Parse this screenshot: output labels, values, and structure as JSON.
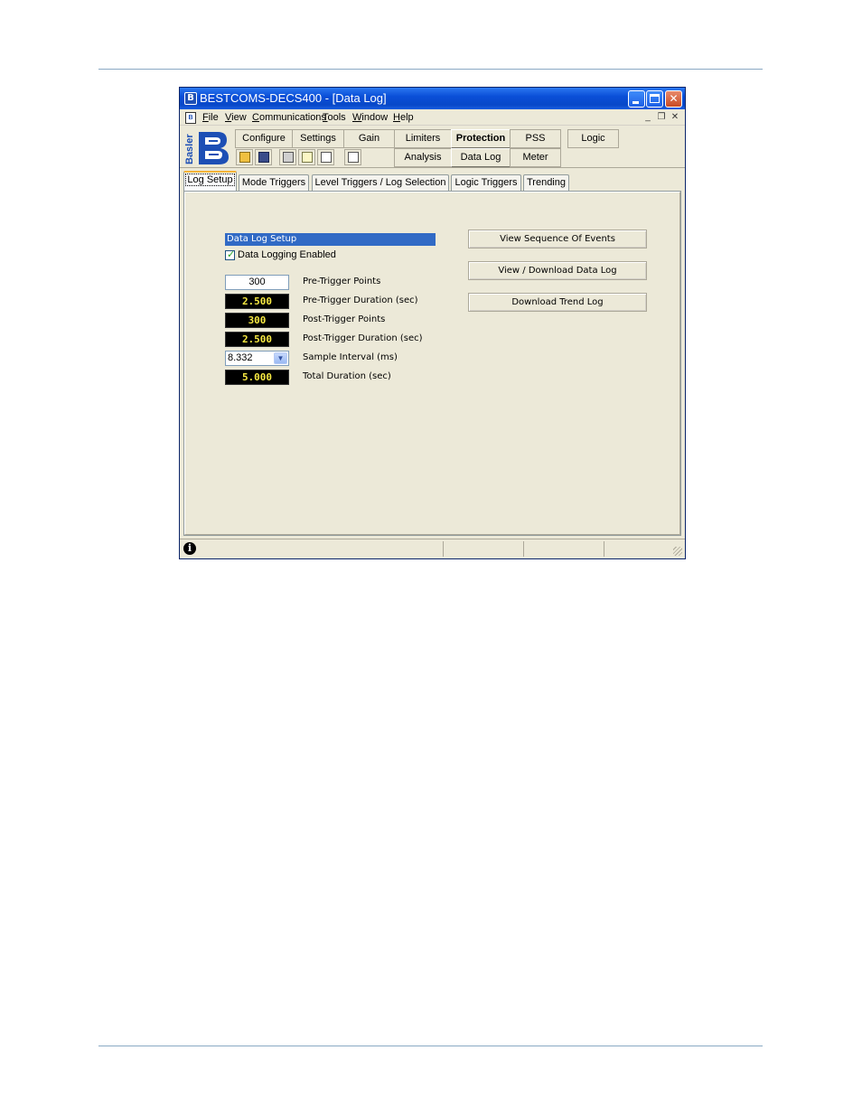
{
  "window": {
    "title": "BESTCOMS-DECS400 - [Data Log]"
  },
  "menu": {
    "items": [
      "File",
      "View",
      "Communications",
      "Tools",
      "Window",
      "Help"
    ],
    "mdi": {
      "minimize": "_",
      "restore": "❐",
      "close": "✕"
    }
  },
  "logo": {
    "brand": "Basler"
  },
  "nav": {
    "row1": [
      "Configure",
      "Settings",
      "Gain",
      "Limiters",
      "Protection",
      "PSS",
      "Logic"
    ],
    "row2": [
      "Analysis",
      "Data Log",
      "Meter"
    ]
  },
  "tabs": [
    "Log Setup",
    "Mode Triggers",
    "Level Triggers / Log Selection",
    "Logic Triggers",
    "Trending"
  ],
  "data_log_setup": {
    "header": "Data Log Setup",
    "enabled_label": "Data Logging Enabled",
    "enabled": true,
    "fields": [
      {
        "value": "300",
        "label": "Pre-Trigger Points"
      },
      {
        "value": "2.500",
        "label": "Pre-Trigger Duration (sec)"
      },
      {
        "value": "300",
        "label": "Post-Trigger Points"
      },
      {
        "value": "2.500",
        "label": "Post-Trigger Duration (sec)"
      },
      {
        "value": "8.332",
        "label": "Sample Interval (ms)"
      },
      {
        "value": "5.000",
        "label": "Total Duration (sec)"
      }
    ]
  },
  "actions": {
    "view_soe": "View Sequence Of Events",
    "view_download": "View / Download Data Log",
    "download_trend": "Download Trend Log"
  },
  "colors": {
    "title_bar": "#0a4fd8",
    "header_bg": "#316ac5",
    "readout_bg": "#000000",
    "readout_fg": "#f6e842",
    "window_bg": "#ece9d8"
  }
}
